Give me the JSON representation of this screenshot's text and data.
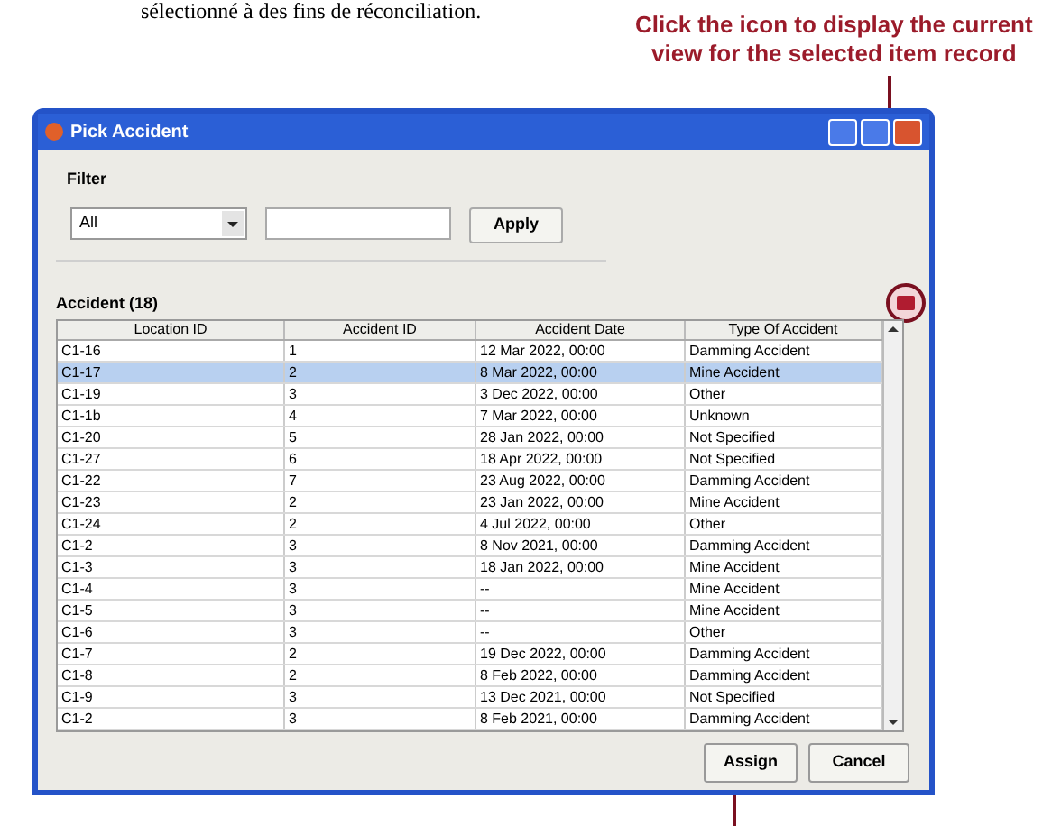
{
  "doc_text": "sélectionné à des fins de réconciliation.",
  "callout": {
    "line_1": "Click the icon to display the current",
    "line_2": "view for the selected item record"
  },
  "window": {
    "title": "Pick Accident"
  },
  "filter": {
    "label": "Filter",
    "dropdown": "All",
    "button": "Apply"
  },
  "grid": {
    "caption": "Accident (18)",
    "columns": [
      "Location ID",
      "Accident ID",
      "Accident Date",
      "Type Of Accident"
    ],
    "rows": [
      {
        "cells": [
          "C1-16",
          "1",
          "12 Mar 2022, 00:00",
          "Damming Accident"
        ],
        "selected": false
      },
      {
        "cells": [
          "C1-17",
          "2",
          "8 Mar 2022, 00:00",
          "Mine Accident"
        ],
        "selected": true
      },
      {
        "cells": [
          "C1-19",
          "3",
          "3 Dec 2022, 00:00",
          "Other"
        ],
        "selected": false
      },
      {
        "cells": [
          "C1-1b",
          "4",
          "7 Mar 2022, 00:00",
          "Unknown"
        ],
        "selected": false
      },
      {
        "cells": [
          "C1-20",
          "5",
          "28 Jan 2022, 00:00",
          "Not Specified"
        ],
        "selected": false
      },
      {
        "cells": [
          "C1-27",
          "6",
          "18 Apr 2022, 00:00",
          "Not Specified"
        ],
        "selected": false
      },
      {
        "cells": [
          "C1-22",
          "7",
          "23 Aug 2022, 00:00",
          "Damming Accident"
        ],
        "selected": false
      },
      {
        "cells": [
          "C1-23",
          "2",
          "23 Jan 2022, 00:00",
          "Mine Accident"
        ],
        "selected": false
      },
      {
        "cells": [
          "C1-24",
          "2",
          "4 Jul 2022, 00:00",
          "Other"
        ],
        "selected": false
      },
      {
        "cells": [
          "C1-2",
          "3",
          "8 Nov 2021, 00:00",
          "Damming Accident"
        ],
        "selected": false
      },
      {
        "cells": [
          "C1-3",
          "3",
          "18 Jan 2022, 00:00",
          "Mine Accident"
        ],
        "selected": false
      },
      {
        "cells": [
          "C1-4",
          "3",
          "--",
          "Mine Accident"
        ],
        "selected": false
      },
      {
        "cells": [
          "C1-5",
          "3",
          "--",
          "Mine Accident"
        ],
        "selected": false
      },
      {
        "cells": [
          "C1-6",
          "3",
          "--",
          "Other"
        ],
        "selected": false
      },
      {
        "cells": [
          "C1-7",
          "2",
          "19 Dec 2022, 00:00",
          "Damming Accident"
        ],
        "selected": false
      },
      {
        "cells": [
          "C1-8",
          "2",
          "8 Feb 2022, 00:00",
          "Damming Accident"
        ],
        "selected": false
      },
      {
        "cells": [
          "C1-9",
          "3",
          "13 Dec 2021, 00:00",
          "Not Specified"
        ],
        "selected": false
      },
      {
        "cells": [
          "C1-2",
          "3",
          "8 Feb 2021, 00:00",
          "Damming Accident"
        ],
        "selected": false
      }
    ]
  },
  "buttons": [
    "Assign",
    "Cancel"
  ]
}
